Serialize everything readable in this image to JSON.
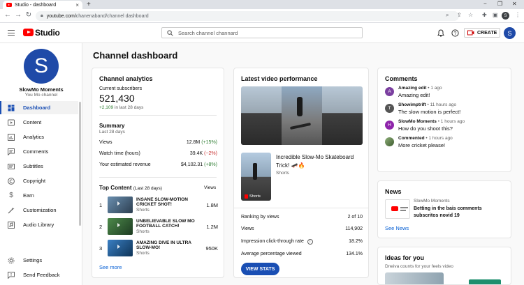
{
  "browser": {
    "tab_title": "Studio - dashboard",
    "url_host": "youtube.com/",
    "url_path": "chanenaband/channel dashboard"
  },
  "header": {
    "logo_text": "Studio",
    "search_placeholder": "Search channel channard",
    "create_label": "CREATE",
    "avatar_letter": "S"
  },
  "channel": {
    "avatar_letter": "S",
    "name": "SlowMo Moments",
    "subtitle": "You Mo channel"
  },
  "sidebar": {
    "items": [
      {
        "label": "Dashboard",
        "icon": "dashboard-icon"
      },
      {
        "label": "Content",
        "icon": "content-icon"
      },
      {
        "label": "Analytics",
        "icon": "analytics-icon"
      },
      {
        "label": "Comments",
        "icon": "comments-icon"
      },
      {
        "label": "Subtitles",
        "icon": "subtitles-icon"
      },
      {
        "label": "Copyright",
        "icon": "copyright-icon"
      },
      {
        "label": "Earn",
        "icon": "dollar-icon"
      },
      {
        "label": "Customization",
        "icon": "wand-icon"
      },
      {
        "label": "Audio Library",
        "icon": "audio-icon"
      }
    ],
    "settings": "Settings",
    "feedback": "Send Feedback"
  },
  "page_title": "Channel dashboard",
  "analytics": {
    "title": "Channel analytics",
    "subs_label": "Current subscribers",
    "subs_value": "521,430",
    "subs_delta": "+2,109",
    "subs_delta_suffix": "in last 28 days",
    "summary_title": "Summary",
    "summary_period": "Last 28 days",
    "metrics": [
      {
        "label": "Views",
        "value": "12.8M",
        "delta": "(+15%)"
      },
      {
        "label": "Watch time (hours)",
        "value": "39.4K",
        "delta": "(−2%)"
      },
      {
        "label": "Your estimated revenue",
        "value": "$4,102.31",
        "delta": "(+8%)"
      }
    ],
    "top_content_title": "Top Content",
    "top_content_period": "(Last 28 days)",
    "top_content_views_header": "Views",
    "top_content": [
      {
        "rank": "1",
        "title": "INSANE SLOW-MOTION CRICKET SHOT!",
        "type": "Shorts",
        "views": "1.8M"
      },
      {
        "rank": "2",
        "title": "UNBELIEVABLE SLOW MO FOOTBALL CATCH!",
        "type": "Shorts",
        "views": "1.2M"
      },
      {
        "rank": "3",
        "title": "AMAZING DIVE IN ULTRA SLOW-MO!",
        "type": "Shorts",
        "views": "950K"
      }
    ],
    "see_more": "See more"
  },
  "latest": {
    "title": "Latest video performance",
    "video_title": "Incredible Slow-Mo Skateboard Trick! 🛹🔥",
    "video_type": "Shorts",
    "shorts_badge": "Shorts",
    "stats": [
      {
        "label": "Ranking by views",
        "value": "2 of 10"
      },
      {
        "label": "Views",
        "value": "114,902"
      },
      {
        "label": "Impression click-through rate",
        "value": "18.2%"
      },
      {
        "label": "Average percentage viewed",
        "value": "134.1%"
      }
    ],
    "button": "VIEW STATS"
  },
  "comments": {
    "title": "Comments",
    "items": [
      {
        "avatar": "A",
        "color": "#7b3fa0",
        "author": "Amazing edit",
        "time": "• 1 ago",
        "text": "Amazing edit!"
      },
      {
        "avatar": "T",
        "color": "#555555",
        "author": "Showimptrift",
        "time": "• 11 hours ago",
        "text": "The slow motion is perfect!"
      },
      {
        "avatar": "H",
        "color": "#8e24aa",
        "author": "SlowMo Moments",
        "time": "• 1 hours ago",
        "text": "How do you shoot this?"
      },
      {
        "avatar": "",
        "color": "#6d8f5a",
        "author": "Commented",
        "time": "• 1 hours ago",
        "text": "More cricket please!"
      }
    ]
  },
  "news": {
    "title": "News",
    "source": "SlowMo Moments",
    "headline": "Betting in the bais comments subscritos novid 19",
    "link": "See News"
  },
  "ideas": {
    "title": "Ideas for you",
    "subtitle": "Dneiva counts for your feels video"
  }
}
